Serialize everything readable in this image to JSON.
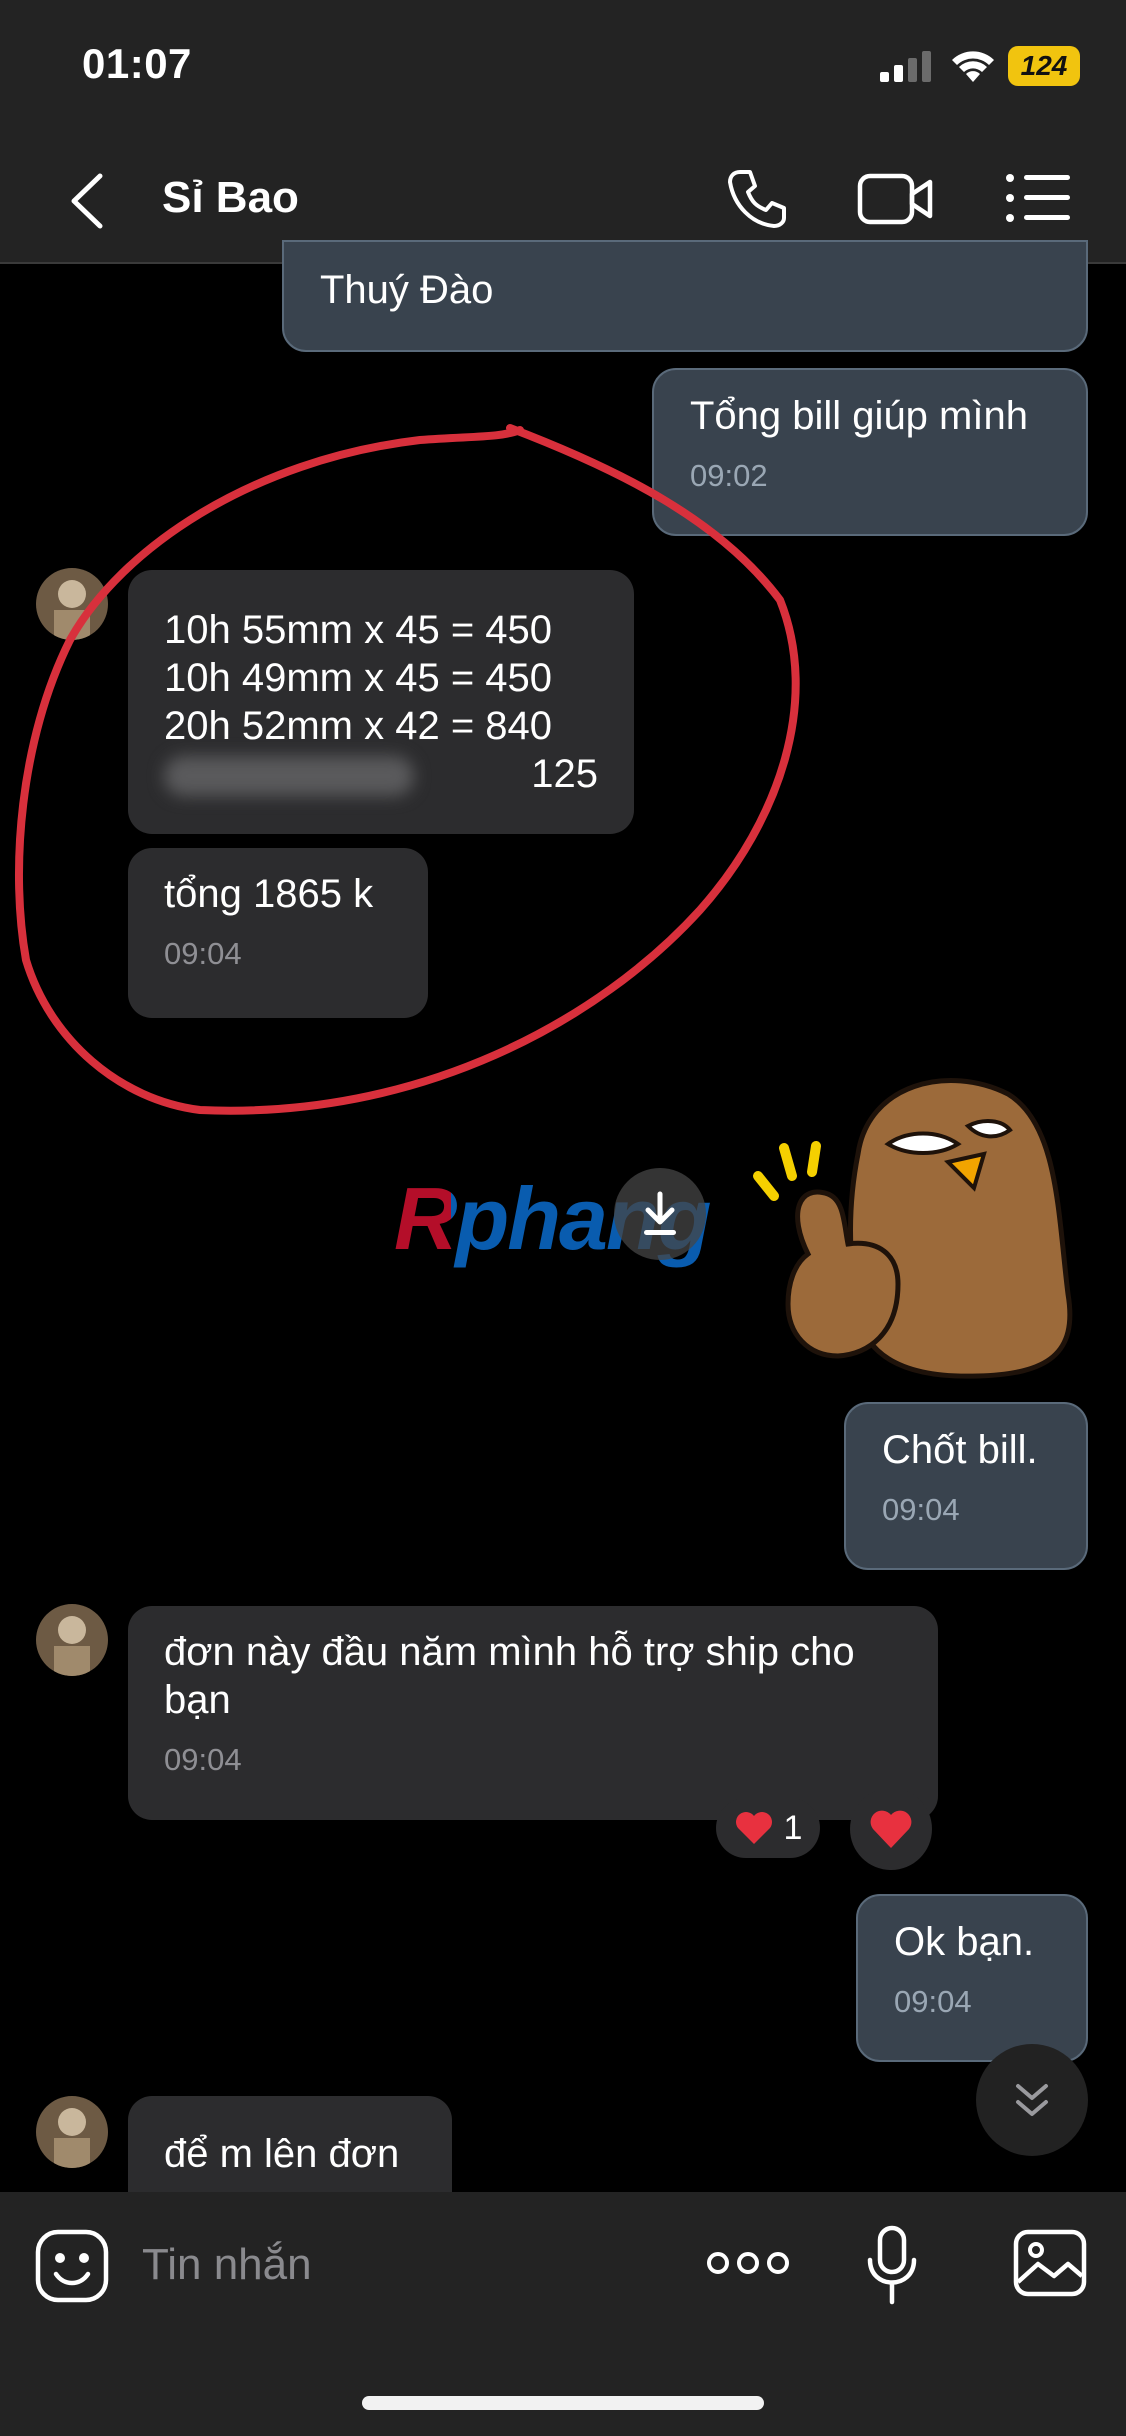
{
  "status_bar": {
    "time": "01:07",
    "battery": "124"
  },
  "header": {
    "contact_name": "Sỉ Bao"
  },
  "messages": [
    {
      "text": "Thuý Đào"
    },
    {
      "text": "Tổng bill giúp mình",
      "time": "09:02"
    },
    {
      "lines": [
        "10h 55mm x 45 = 450",
        "10h 49mm x 45 = 450",
        "20h 52mm x 42 = 840",
        "125"
      ]
    },
    {
      "text": "tổng 1865 k",
      "time": "09:04"
    },
    {
      "text": "Chốt bill.",
      "time": "09:04"
    },
    {
      "text": "đơn này đầu năm mình hỗ trợ ship cho bạn",
      "time": "09:04"
    },
    {
      "text": "Ok bạn.",
      "time": "09:04"
    },
    {
      "text": "để m lên đơn"
    }
  ],
  "reactions": {
    "count": "1"
  },
  "watermark": "Rphang",
  "input": {
    "placeholder": "Tin nhắn"
  },
  "colors": {
    "incoming": "#2c2c2e",
    "outgoing": "#39434e",
    "annotation": "#d8303c",
    "background": "#000000"
  },
  "icons": [
    "back-icon",
    "phone-icon",
    "video-icon",
    "menu-icon",
    "emoji-icon",
    "more-icon",
    "mic-icon",
    "image-icon",
    "heart-icon",
    "chevrons-down-icon"
  ]
}
